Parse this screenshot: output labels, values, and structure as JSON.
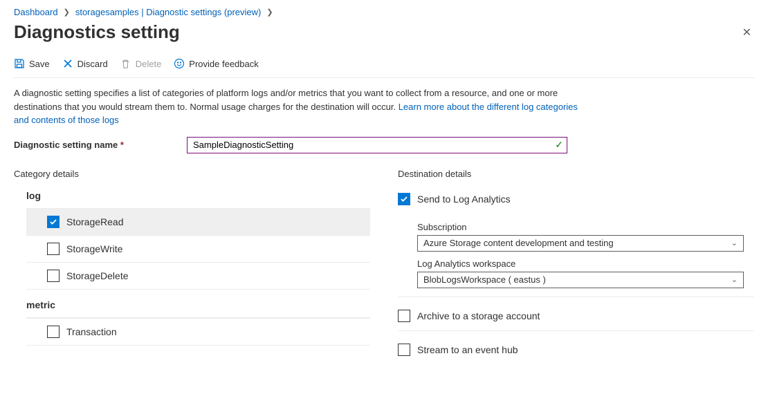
{
  "breadcrumb": {
    "item1": "Dashboard",
    "item2": "storagesamples | Diagnostic settings (preview)"
  },
  "title": "Diagnostics setting",
  "toolbar": {
    "save": "Save",
    "discard": "Discard",
    "delete": "Delete",
    "feedback": "Provide feedback"
  },
  "description": {
    "text1": "A diagnostic setting specifies a list of categories of platform logs and/or metrics that you want to collect from a resource, and one or more destinations that you would stream them to. Normal usage charges for the destination will occur. ",
    "link": "Learn more about the different log categories and contents of those logs"
  },
  "name_field": {
    "label": "Diagnostic setting name",
    "value": "SampleDiagnosticSetting"
  },
  "category": {
    "heading": "Category details",
    "log_label": "log",
    "logs": [
      {
        "label": "StorageRead",
        "checked": true
      },
      {
        "label": "StorageWrite",
        "checked": false
      },
      {
        "label": "StorageDelete",
        "checked": false
      }
    ],
    "metric_label": "metric",
    "metrics": [
      {
        "label": "Transaction",
        "checked": false
      }
    ]
  },
  "destination": {
    "heading": "Destination details",
    "send_log_analytics": {
      "label": "Send to Log Analytics",
      "checked": true
    },
    "subscription_label": "Subscription",
    "subscription_value": "Azure Storage content development and testing",
    "workspace_label": "Log Analytics workspace",
    "workspace_value": "BlobLogsWorkspace ( eastus )",
    "archive": {
      "label": "Archive to a storage account",
      "checked": false
    },
    "stream": {
      "label": "Stream to an event hub",
      "checked": false
    }
  }
}
